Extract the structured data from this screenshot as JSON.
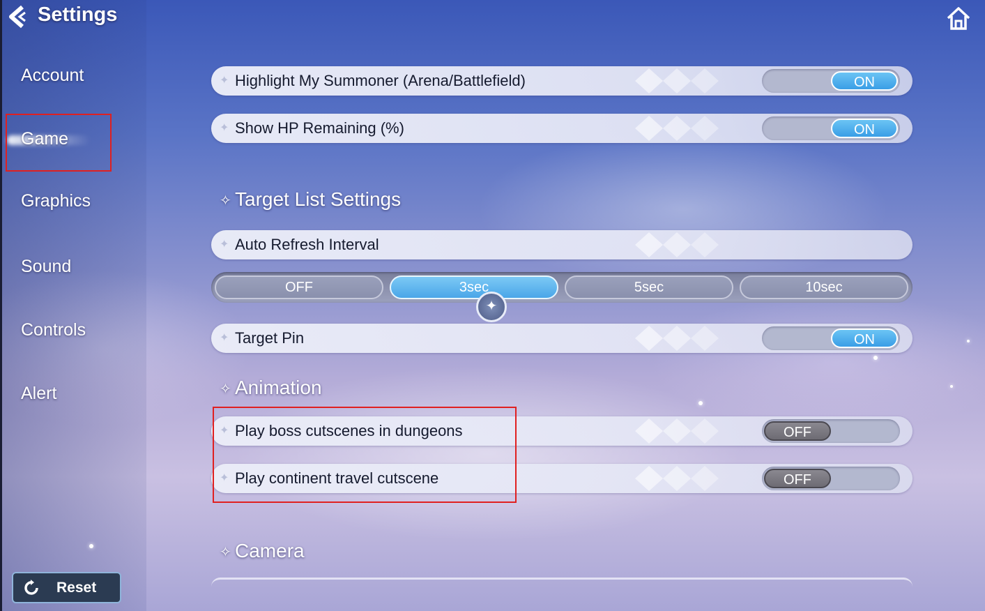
{
  "header": {
    "title": "Settings",
    "back_icon": "chevron-left-icon",
    "home_icon": "home-icon"
  },
  "sidebar": {
    "items": [
      {
        "label": "Account"
      },
      {
        "label": "Game"
      },
      {
        "label": "Graphics"
      },
      {
        "label": "Sound"
      },
      {
        "label": "Controls"
      },
      {
        "label": "Alert"
      }
    ],
    "active": "Game",
    "reset_label": "Reset",
    "reset_icon": "reset-icon"
  },
  "settings": {
    "highlight_summoner": {
      "label": "Highlight My Summoner (Arena/Battlefield)",
      "state": "ON"
    },
    "show_hp": {
      "label": "Show HP Remaining (%)",
      "state": "ON"
    },
    "target_list": {
      "title": "Target List Settings",
      "auto_refresh": {
        "label": "Auto Refresh Interval",
        "options": [
          "OFF",
          "3sec",
          "5sec",
          "10sec"
        ],
        "selected": "3sec"
      },
      "target_pin": {
        "label": "Target Pin",
        "state": "ON"
      }
    },
    "animation": {
      "title": "Animation",
      "boss_cutscenes": {
        "label": "Play boss cutscenes in dungeons",
        "state": "OFF"
      },
      "continent_cutscene": {
        "label": "Play continent travel cutscene",
        "state": "OFF"
      }
    },
    "camera": {
      "title": "Camera"
    }
  },
  "colors": {
    "toggle_on": "#3a9ee6",
    "toggle_off": "#6d6b73",
    "highlight_border": "#e02020"
  }
}
